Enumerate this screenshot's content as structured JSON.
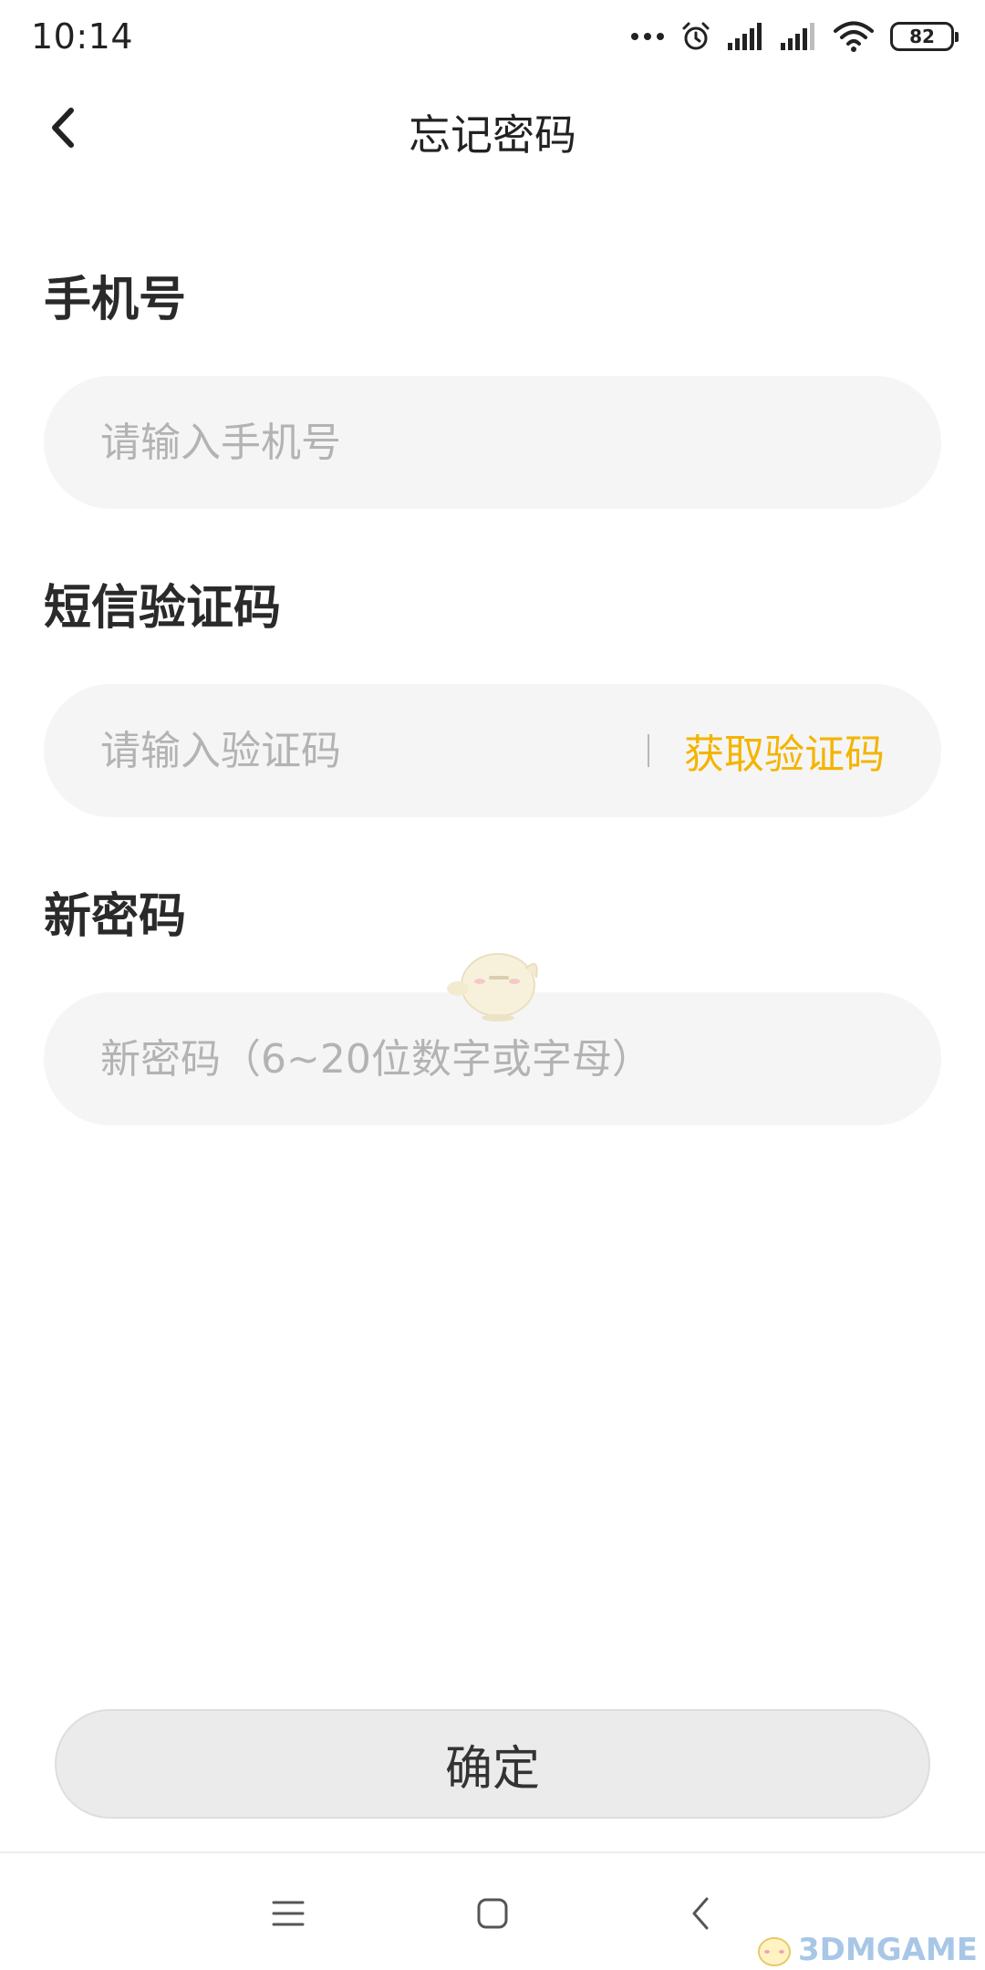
{
  "status_bar": {
    "time": "10:14",
    "battery": "82",
    "icons": [
      "more-dots-icon",
      "alarm-icon",
      "signal-icon",
      "signal-icon",
      "wifi-icon",
      "battery-icon"
    ]
  },
  "header": {
    "title": "忘记密码",
    "back_icon": "chevron-left-icon"
  },
  "form": {
    "phone": {
      "label": "手机号",
      "placeholder": "请输入手机号",
      "value": ""
    },
    "sms_code": {
      "label": "短信验证码",
      "placeholder": "请输入验证码",
      "value": "",
      "get_code_label": "获取验证码"
    },
    "new_password": {
      "label": "新密码",
      "placeholder": "新密码（6~20位数字或字母）",
      "value": ""
    }
  },
  "confirm_label": "确定",
  "nav_bar": {
    "icons": [
      "menu-icon",
      "home-icon",
      "back-icon"
    ]
  },
  "watermark": "3DMGAME",
  "colors": {
    "accent": "#f4b400",
    "field_bg": "#f5f5f5",
    "button_bg": "#ebebeb",
    "placeholder": "#b3b3b3"
  }
}
